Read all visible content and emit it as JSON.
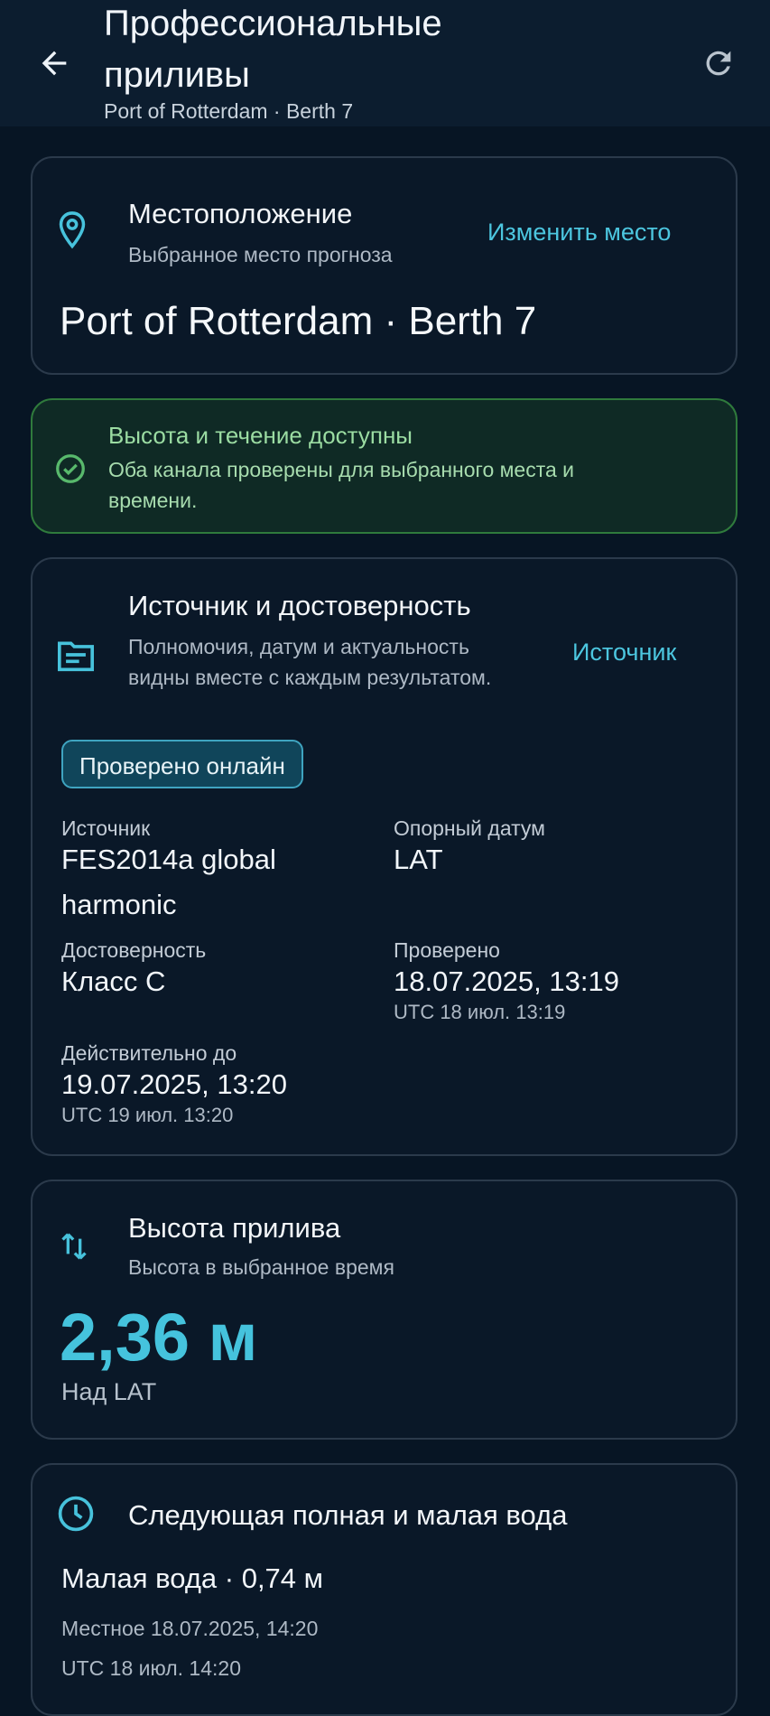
{
  "appbar": {
    "title": "Профессиональные приливы",
    "subtitle": "Port of Rotterdam · Berth 7",
    "back_icon": "arrow-left-icon",
    "refresh_icon": "refresh-icon"
  },
  "location": {
    "heading": "Местоположение",
    "description": "Выбранное место прогноза",
    "change_label": "Изменить место",
    "name": "Port of Rotterdam · Berth 7",
    "icon": "location-pin-icon"
  },
  "status": {
    "heading": "Высота и течение доступны",
    "message": "Оба канала проверены для выбранного места и времени.",
    "icon": "check-circle-icon",
    "color": "#2f7a3c"
  },
  "source": {
    "heading": "Источник и достоверность",
    "description": "Полномочия, датум и актуальность видны вместе с каждым результатом.",
    "link_label": "Источник",
    "badge": "Проверено онлайн",
    "icon": "document-icon",
    "fields": {
      "source_label": "Источник",
      "source_value": "FES2014a global harmonic",
      "datum_label": "Опорный датум",
      "datum_value": "LAT",
      "reliability_label": "Достоверность",
      "reliability_value": "Класс C",
      "verified_label": "Проверено",
      "verified_value": "18.07.2025, 13:19",
      "verified_utc": "UTC 18 июл. 13:19",
      "valid_label": "Действительно до",
      "valid_value": "19.07.2025, 13:20",
      "valid_utc": "UTC 19 июл. 13:20"
    }
  },
  "height": {
    "heading": "Высота прилива",
    "description": "Высота в выбранное время",
    "value": "2,36 м",
    "reference": "Над LAT",
    "icon": "swap-vertical-icon",
    "accent": "#45c3dd"
  },
  "next_water": {
    "heading": "Следующая полная и малая вода",
    "low_water": "Малая вода · 0,74 м",
    "local_time": "Местное 18.07.2025, 14:20",
    "utc_time": "UTC 18 июл. 14:20",
    "icon": "clock-icon"
  }
}
